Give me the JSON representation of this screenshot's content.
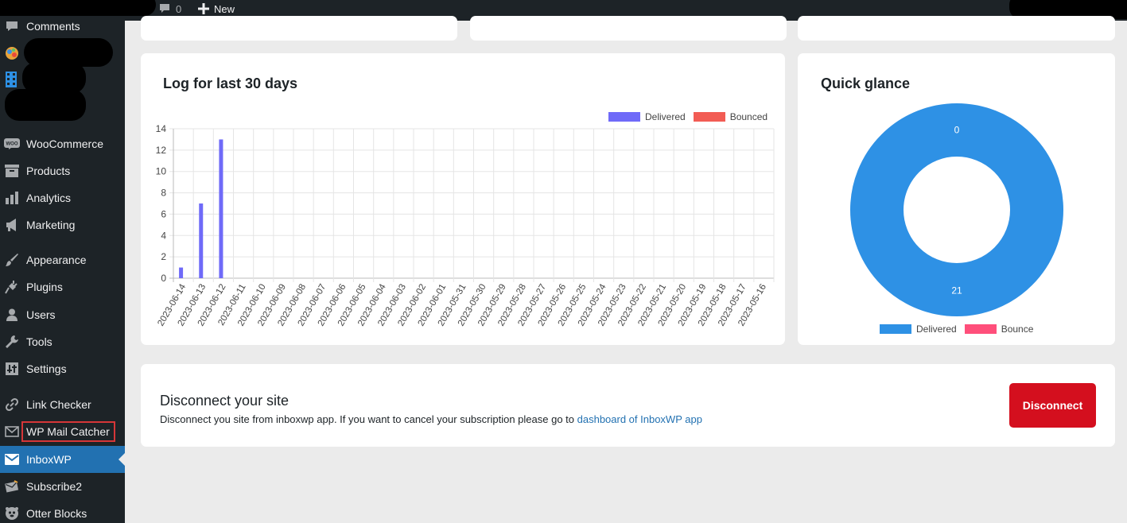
{
  "admin_bar": {
    "comments_count": "0",
    "new_label": "New"
  },
  "sidebar": {
    "items": [
      {
        "label": "Comments",
        "icon": "comment-icon"
      },
      {
        "label": "WooCommerce",
        "icon": "woocommerce-icon"
      },
      {
        "label": "Products",
        "icon": "archive-icon"
      },
      {
        "label": "Analytics",
        "icon": "bar-chart-icon"
      },
      {
        "label": "Marketing",
        "icon": "megaphone-icon"
      },
      {
        "label": "Appearance",
        "icon": "paintbrush-icon"
      },
      {
        "label": "Plugins",
        "icon": "plug-icon"
      },
      {
        "label": "Users",
        "icon": "user-icon"
      },
      {
        "label": "Tools",
        "icon": "wrench-icon"
      },
      {
        "label": "Settings",
        "icon": "settings-sliders-icon"
      },
      {
        "label": "Link Checker",
        "icon": "link-icon"
      },
      {
        "label": "WP Mail Catcher",
        "icon": "envelope-outline-icon"
      },
      {
        "label": "InboxWP",
        "icon": "envelope-icon",
        "current": true
      },
      {
        "label": "Subscribe2",
        "icon": "subscribe2-icon"
      },
      {
        "label": "Otter Blocks",
        "icon": "otter-icon"
      }
    ],
    "accent_color": "#2271b1",
    "highlight_color": "#d63638"
  },
  "log_card": {
    "title": "Log for last 30 days"
  },
  "glance_card": {
    "title": "Quick glance"
  },
  "disconnect": {
    "title": "Disconnect your site",
    "text": "Disconnect you site from inboxwp app. If you want to cancel your subscription please go to ",
    "link_text": "dashboard of InboxWP app",
    "button_label": "Disconnect",
    "button_color": "#d40f1e"
  },
  "chart_data": [
    {
      "type": "bar",
      "categories": [
        "2023-06-14",
        "2023-06-13",
        "2023-06-12",
        "2023-06-11",
        "2023-06-10",
        "2023-06-09",
        "2023-06-08",
        "2023-06-07",
        "2023-06-06",
        "2023-06-05",
        "2023-06-04",
        "2023-06-03",
        "2023-06-02",
        "2023-06-01",
        "2023-05-31",
        "2023-05-30",
        "2023-05-29",
        "2023-05-28",
        "2023-05-27",
        "2023-05-26",
        "2023-05-25",
        "2023-05-24",
        "2023-05-23",
        "2023-05-22",
        "2023-05-21",
        "2023-05-20",
        "2023-05-19",
        "2023-05-18",
        "2023-05-17",
        "2023-05-16"
      ],
      "series": [
        {
          "name": "Delivered",
          "color": "#6f6af8",
          "values": [
            1,
            7,
            13,
            0,
            0,
            0,
            0,
            0,
            0,
            0,
            0,
            0,
            0,
            0,
            0,
            0,
            0,
            0,
            0,
            0,
            0,
            0,
            0,
            0,
            0,
            0,
            0,
            0,
            0,
            0
          ]
        },
        {
          "name": "Bounced",
          "color": "#f25c54",
          "values": [
            0,
            0,
            0,
            0,
            0,
            0,
            0,
            0,
            0,
            0,
            0,
            0,
            0,
            0,
            0,
            0,
            0,
            0,
            0,
            0,
            0,
            0,
            0,
            0,
            0,
            0,
            0,
            0,
            0,
            0
          ]
        }
      ],
      "yticks": [
        "0",
        "2",
        "4",
        "6",
        "8",
        "10",
        "12",
        "14"
      ],
      "ylim": [
        0,
        14
      ],
      "grid": true,
      "legend": "top-right"
    },
    {
      "type": "pie",
      "donut": true,
      "labels": [
        "Delivered",
        "Bounce"
      ],
      "values": [
        21,
        0
      ],
      "colors": [
        "#2e91e5",
        "#ff4f7b"
      ],
      "data_labels": [
        "21",
        "0"
      ],
      "legend": "bottom"
    }
  ]
}
